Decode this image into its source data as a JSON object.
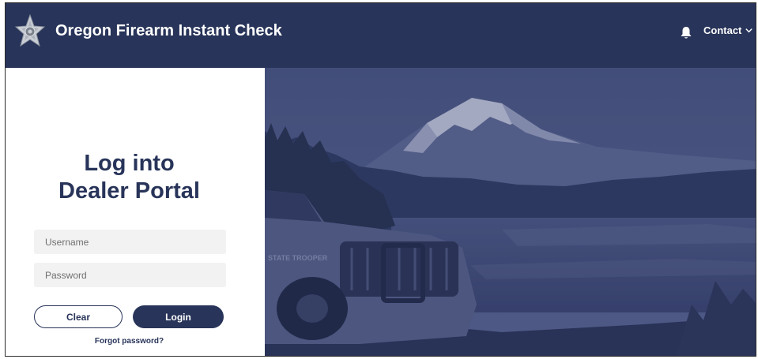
{
  "header": {
    "title": "Oregon Firearm Instant Check",
    "contact_label": "Contact",
    "bg_color": "#283459"
  },
  "login": {
    "heading_line1": "Log into",
    "heading_line2": "Dealer Portal",
    "username_placeholder": "Username",
    "password_placeholder": "Password",
    "clear_label": "Clear",
    "login_label": "Login",
    "forgot_label": "Forgot password?"
  },
  "background": {
    "vehicle_text": "STATE TROOPER"
  },
  "icons": {
    "logo": "state-police-star-badge",
    "bell": "bell-icon",
    "chevron": "chevron-down-icon"
  }
}
